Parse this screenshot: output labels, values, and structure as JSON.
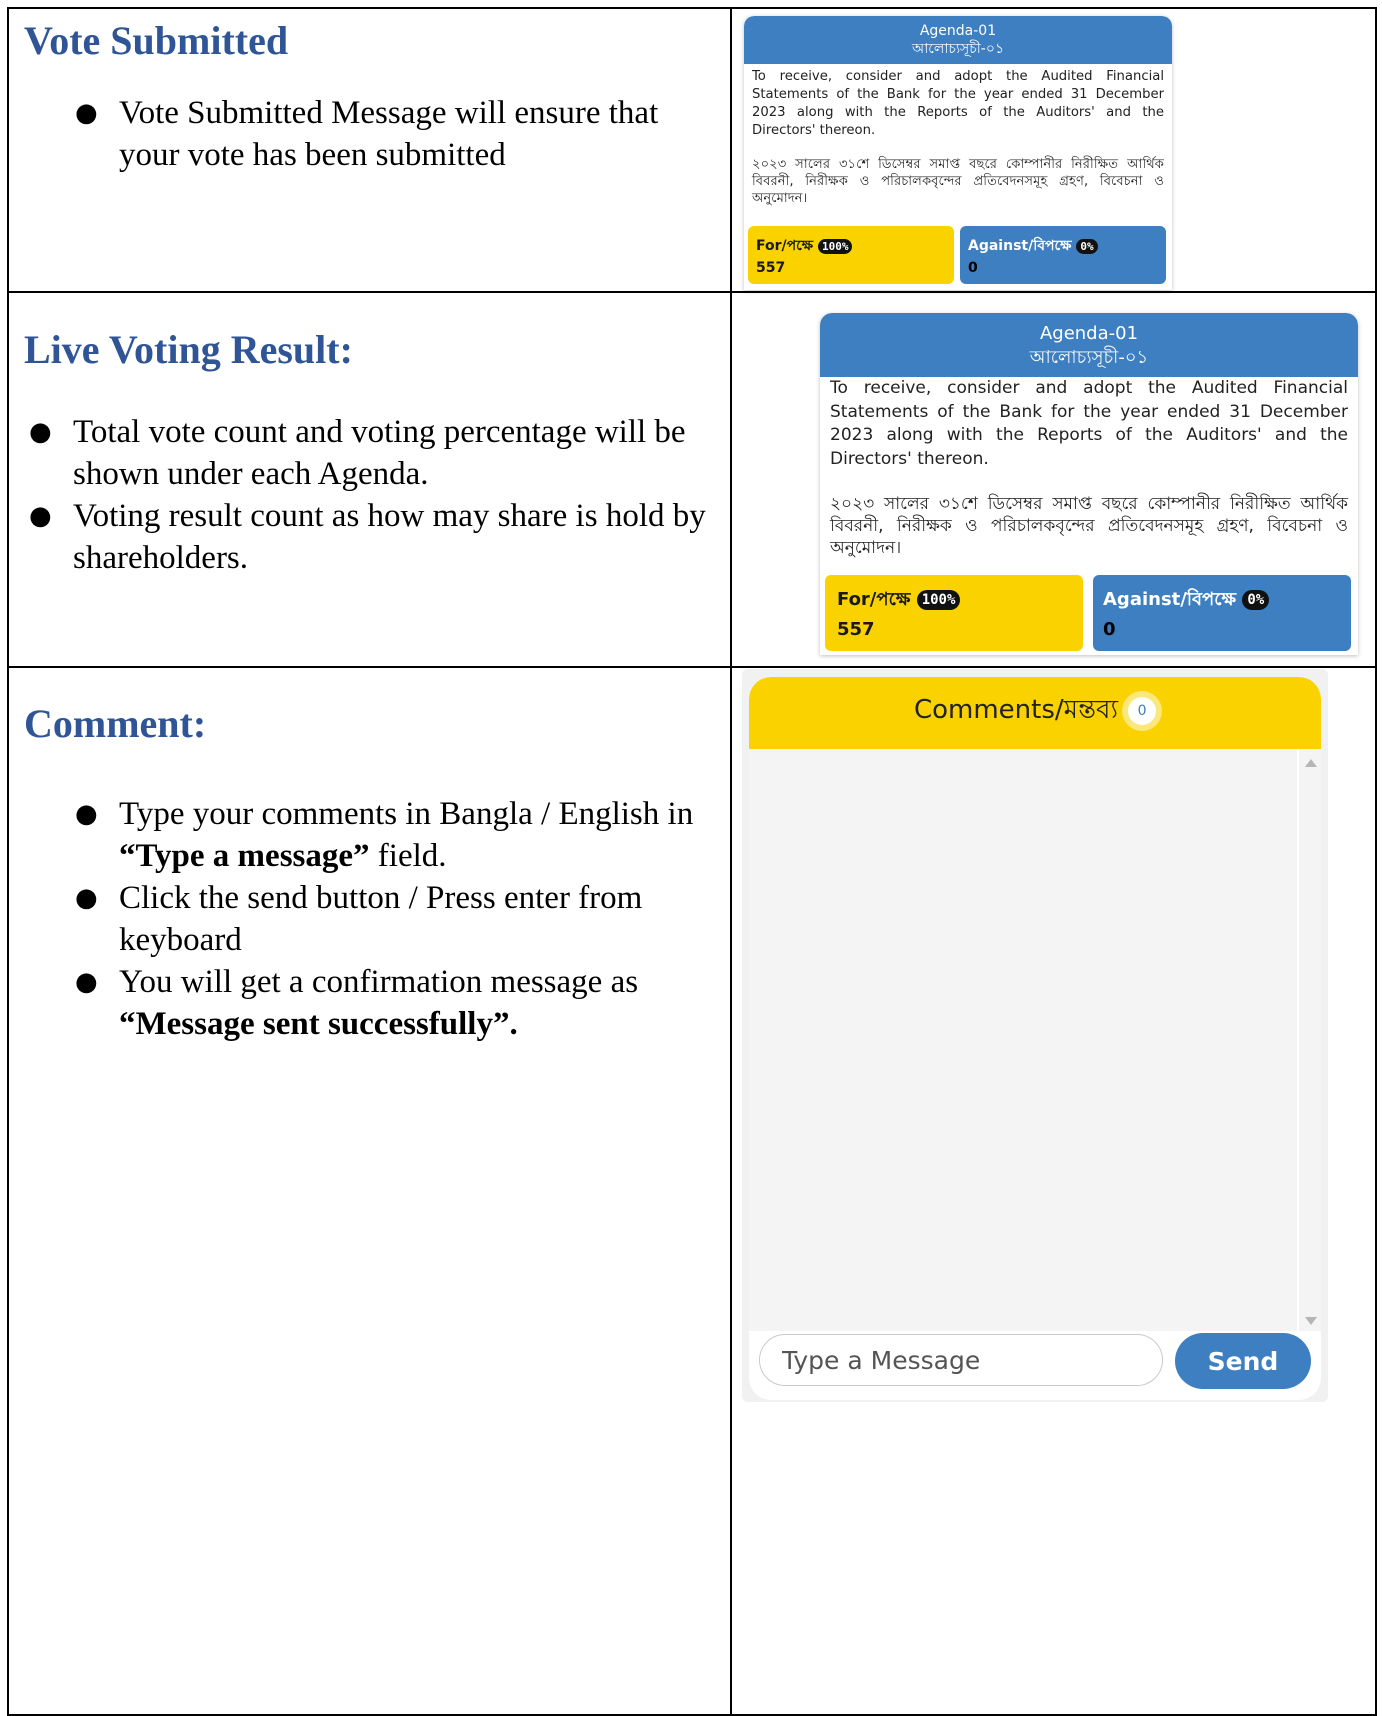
{
  "sections": [
    {
      "title": "Vote Submitted",
      "bullets": [
        "Vote Submitted Message will ensure that your vote has been submitted"
      ]
    },
    {
      "title": "Live Voting Result:",
      "bullets": [
        "Total vote count and voting percentage will be shown under each Agenda.",
        "Voting result count as how may share is hold by shareholders."
      ]
    },
    {
      "title": "Comment:",
      "bullets": {
        "b1_prefix": "Type your comments in Bangla / English in ",
        "b1_bold": "“Type a message”",
        "b1_suffix": " field.",
        "b2": "Click the send button / Press enter from keyboard",
        "b3_prefix": "You will get a confirmation message as ",
        "b3_bold": "“Message sent successfully”."
      }
    }
  ],
  "agenda": {
    "title_en": "Agenda-01",
    "title_bn": "আলোচ্যসূচী-০১",
    "text_en": "To receive, consider and adopt the Audited Financial Statements of the Bank for the year ended 31 December 2023 along with the Reports of the Auditors' and the Directors' thereon.",
    "text_bn": "২০২৩ সালের ৩১শে ডিসেম্বর সমাপ্ত বছরে কোম্পানীর নিরীক্ষিত আর্থিক বিবরনী, নিরীক্ষক ও পরিচালকবৃন্দের প্রতিবেদনসমূহ গ্রহণ, বিবেচনা ও অনুমোদন।",
    "for_label": "For/পক্ষে",
    "for_pct": "100%",
    "for_count": "557",
    "against_label": "Against/বিপক্ষে",
    "against_pct": "0%",
    "against_count": "0",
    "for_fraction": 1.0
  },
  "comments": {
    "header": "Comments/মন্তব্য",
    "count": "0",
    "placeholder": "Type a Message",
    "send_label": "Send"
  },
  "colors": {
    "title_blue": "#2f5597",
    "agenda_blue": "#3d7fc1",
    "for_yellow": "#f9d200"
  }
}
